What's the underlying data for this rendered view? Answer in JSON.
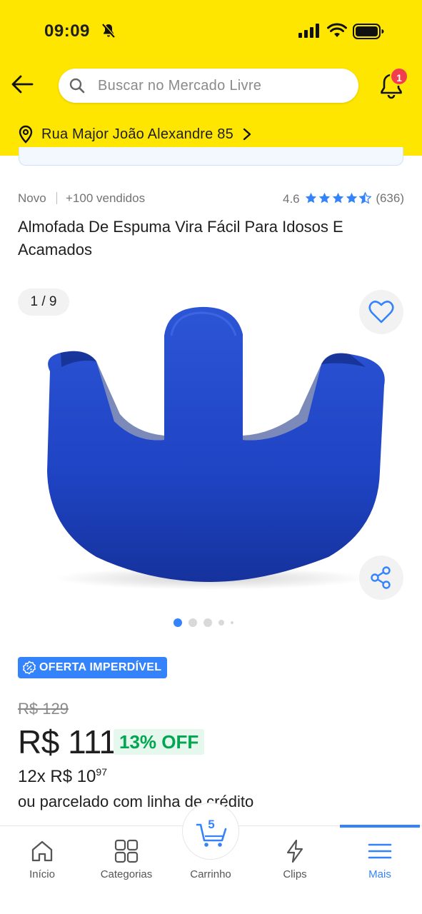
{
  "status_bar": {
    "time": "09:09"
  },
  "search": {
    "placeholder": "Buscar no Mercado Livre"
  },
  "notifications": {
    "count": "1"
  },
  "address": {
    "text": "Rua Major João Alexandre 85"
  },
  "product": {
    "condition": "Novo",
    "sold": "+100 vendidos",
    "rating": "4.6",
    "rating_stars": 4.5,
    "reviews": "(636)",
    "title": "Almofada De Espuma Vira Fácil Para Idosos E Acamados"
  },
  "gallery": {
    "counter": "1 / 9"
  },
  "offer": {
    "badge": "OFERTA IMPERDÍVEL"
  },
  "pricing": {
    "old_price": "R$ 129",
    "price": "R$ 111",
    "discount": "13% OFF",
    "installments_prefix": "12x R$ 10",
    "installments_cents": "97",
    "credit_line": "ou parcelado com linha de crédito"
  },
  "tabbar": {
    "items": [
      {
        "label": "Início",
        "icon": "home-icon"
      },
      {
        "label": "Categorias",
        "icon": "grid-icon"
      },
      {
        "label": "Carrinho",
        "icon": "cart-icon",
        "count": "5"
      },
      {
        "label": "Clips",
        "icon": "bolt-icon"
      },
      {
        "label": "Mais",
        "icon": "menu-icon",
        "active": true
      }
    ]
  },
  "colors": {
    "header_bg": "#FFE600",
    "accent_blue": "#3483FA",
    "discount_green": "#00A650",
    "badge_red": "#F23D4F"
  }
}
